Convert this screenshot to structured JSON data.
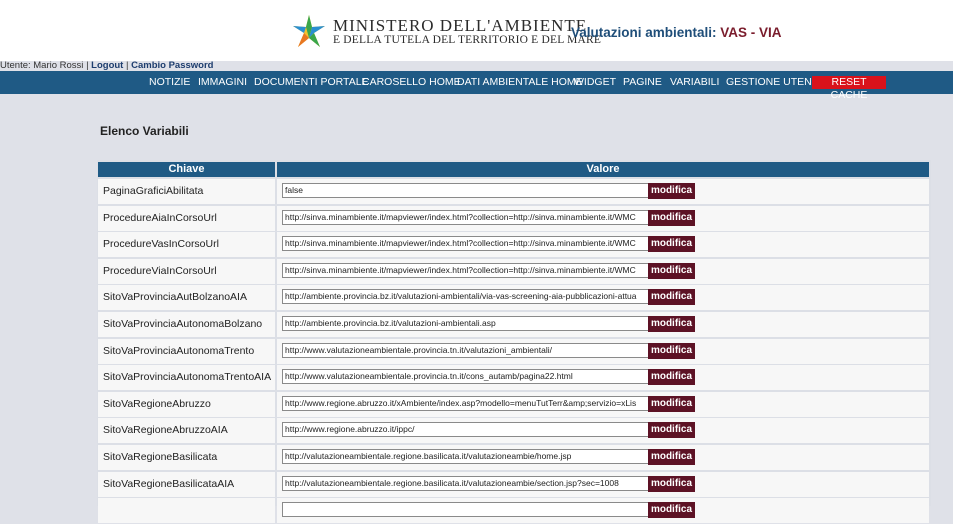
{
  "header": {
    "ministry_line1": "MINISTERO DELL'AMBIENTE",
    "ministry_line2": "E DELLA TUTELA DEL TERRITORIO E DEL MARE",
    "app_title_main": "Valutazioni ambientali:",
    "app_title_accent": "VAS - VIA"
  },
  "userbar": {
    "user_text": "Utente: Mario Rossi",
    "sep1": "|",
    "logout": "Logout",
    "sep2": "|",
    "change_password": "Cambio Password"
  },
  "nav": {
    "items": [
      "NOTIZIE",
      "IMMAGINI",
      "DOCUMENTI PORTALE",
      "CAROSELLO HOME",
      "DATI AMBIENTALE HOME",
      "WIDGET",
      "PAGINE",
      "VARIABILI",
      "GESTIONE UTENTI"
    ],
    "reset_cache": "RESET CACHE"
  },
  "page": {
    "title": "Elenco Variabili"
  },
  "table": {
    "col_key": "Chiave",
    "col_value": "Valore",
    "button_label": "modifica",
    "rows": [
      {
        "key": "PaginaGraficiAbilitata",
        "value": "false"
      },
      {
        "key": "ProcedureAiaInCorsoUrl",
        "value": "http://sinva.minambiente.it/mapviewer/index.html?collection=http://sinva.minambiente.it/WMC"
      },
      {
        "key": "ProcedureVasInCorsoUrl",
        "value": "http://sinva.minambiente.it/mapviewer/index.html?collection=http://sinva.minambiente.it/WMC"
      },
      {
        "key": "ProcedureViaInCorsoUrl",
        "value": "http://sinva.minambiente.it/mapviewer/index.html?collection=http://sinva.minambiente.it/WMC"
      },
      {
        "key": "SitoVaProvinciaAutBolzanoAIA",
        "value": "http://ambiente.provincia.bz.it/valutazioni-ambientali/via-vas-screening-aia-pubblicazioni-attua"
      },
      {
        "key": "SitoVaProvinciaAutonomaBolzano",
        "value": "http://ambiente.provincia.bz.it/valutazioni-ambientali.asp"
      },
      {
        "key": "SitoVaProvinciaAutonomaTrento",
        "value": "http://www.valutazioneambientale.provincia.tn.it/valutazioni_ambientali/"
      },
      {
        "key": "SitoVaProvinciaAutonomaTrentoAIA",
        "value": "http://www.valutazioneambientale.provincia.tn.it/cons_autamb/pagina22.html"
      },
      {
        "key": "SitoVaRegioneAbruzzo",
        "value": "http://www.regione.abruzzo.it/xAmbiente/index.asp?modello=menuTutTerr&amp;servizio=xLis"
      },
      {
        "key": "SitoVaRegioneAbruzzoAIA",
        "value": "http://www.regione.abruzzo.it/ippc/"
      },
      {
        "key": "SitoVaRegioneBasilicata",
        "value": "http://valutazioneambientale.regione.basilicata.it/valutazioneambie/home.jsp"
      },
      {
        "key": "SitoVaRegioneBasilicataAIA",
        "value": "http://valutazioneambientale.regione.basilicata.it/valutazioneambie/section.jsp?sec=1008"
      },
      {
        "key": "",
        "value": ""
      }
    ]
  }
}
